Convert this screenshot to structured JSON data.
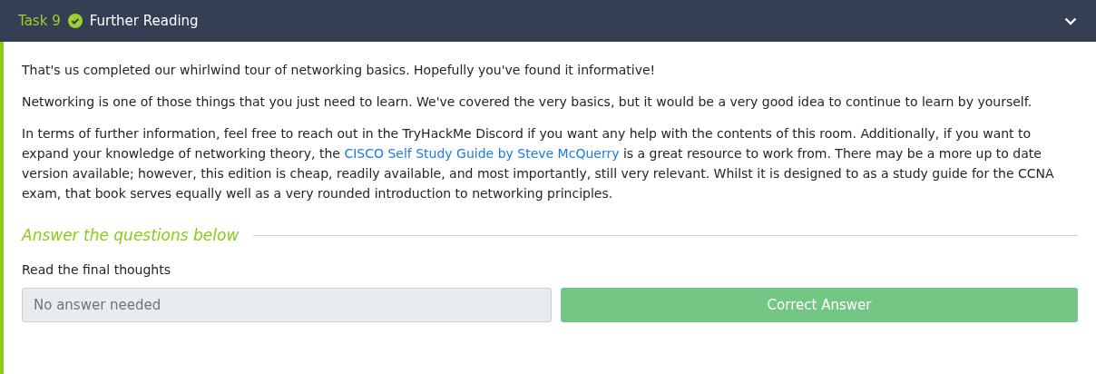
{
  "task": {
    "label": "Task 9",
    "completed": true,
    "title": "Further Reading",
    "expanded": true
  },
  "paragraphs": [
    {
      "parts": [
        {
          "kind": "text",
          "text": "That's us completed our whirlwind tour of networking basics. Hopefully you've found it informative!"
        }
      ]
    },
    {
      "parts": [
        {
          "kind": "text",
          "text": "Networking is one of those things that you just need to learn. We've covered the very basics, but it would be a very good idea to continue to learn by yourself."
        }
      ]
    },
    {
      "parts": [
        {
          "kind": "text",
          "text": "In terms of further information, feel free to reach out in the TryHackMe Discord if you want any help with the contents of this room. Additionally, if you want to expand your knowledge of networking theory, the "
        },
        {
          "kind": "link",
          "text": "CISCO Self Study Guide by Steve McQuerry"
        },
        {
          "kind": "text",
          "text": " is a great resource to work from. There may be a more up to date version available; however, this edition is cheap, readily available, and most importantly, still very relevant. Whilst it is designed to as a study guide for the CCNA exam, that book serves equally well as a very rounded introduction to networking principles."
        }
      ]
    }
  ],
  "questions_heading": "Answer the questions below",
  "questions": [
    {
      "prompt": "Read the final thoughts",
      "answer": "No answer needed",
      "disabled": true,
      "button": "Correct Answer",
      "correct": true
    }
  ]
}
